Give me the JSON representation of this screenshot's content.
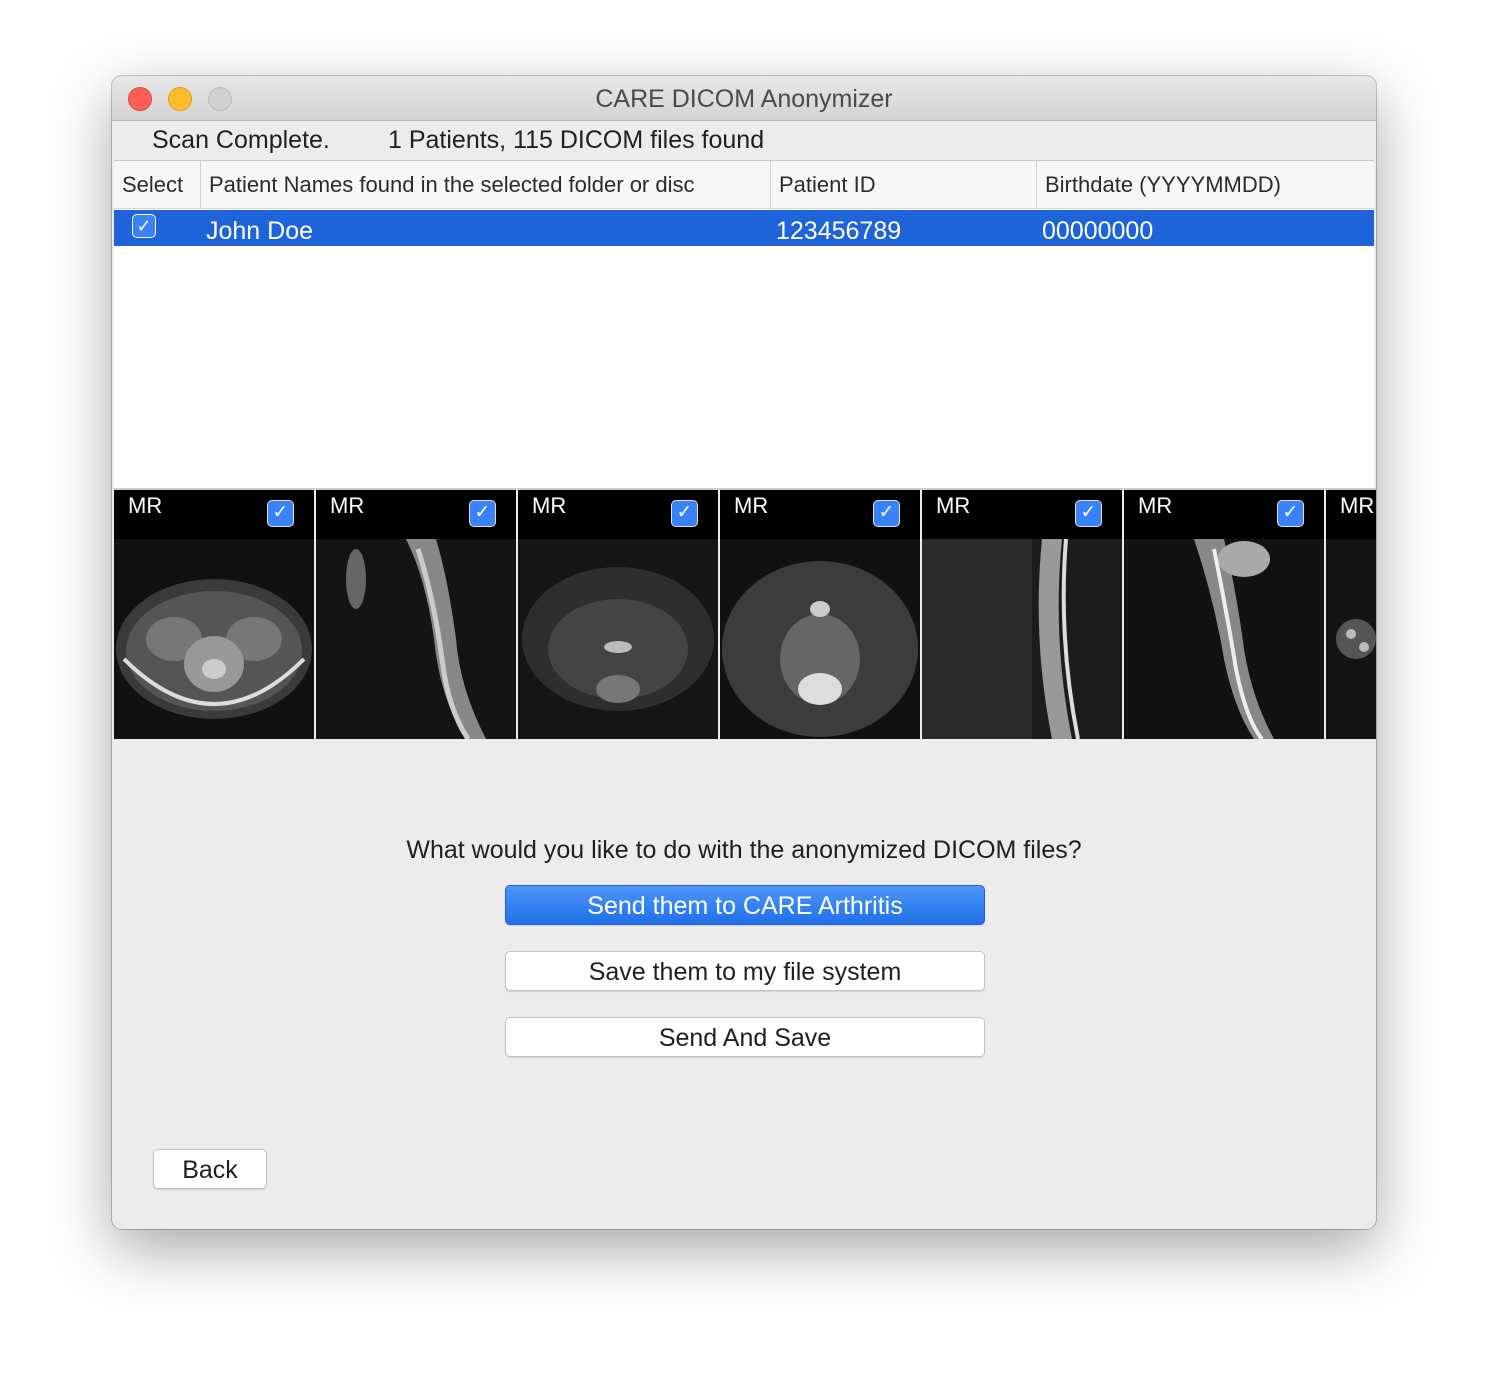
{
  "window": {
    "title": "CARE DICOM Anonymizer"
  },
  "status": {
    "state": "Scan Complete.",
    "summary": "1 Patients, 115 DICOM files found"
  },
  "table": {
    "columns": [
      "Select",
      "Patient Names found in the selected folder or disc",
      "Patient ID",
      "Birthdate (YYYYMMDD)"
    ],
    "rows": [
      {
        "selected": true,
        "name": "John Doe",
        "patient_id": "123456789",
        "birthdate": "00000000"
      }
    ]
  },
  "thumbnails": [
    {
      "modality": "MR",
      "checked": true
    },
    {
      "modality": "MR",
      "checked": true
    },
    {
      "modality": "MR",
      "checked": true
    },
    {
      "modality": "MR",
      "checked": true
    },
    {
      "modality": "MR",
      "checked": true
    },
    {
      "modality": "MR",
      "checked": true
    },
    {
      "modality": "MR",
      "checked": true
    }
  ],
  "actions": {
    "prompt": "What would you like to do with the anonymized DICOM files?",
    "send": "Send them to CARE Arthritis",
    "save": "Save them to my file system",
    "send_and_save": "Send And Save",
    "back": "Back"
  },
  "colors": {
    "selection": "#1e64d8",
    "accent": "#2f7bf5"
  },
  "icons": {
    "checkbox": "checkmark-icon"
  }
}
